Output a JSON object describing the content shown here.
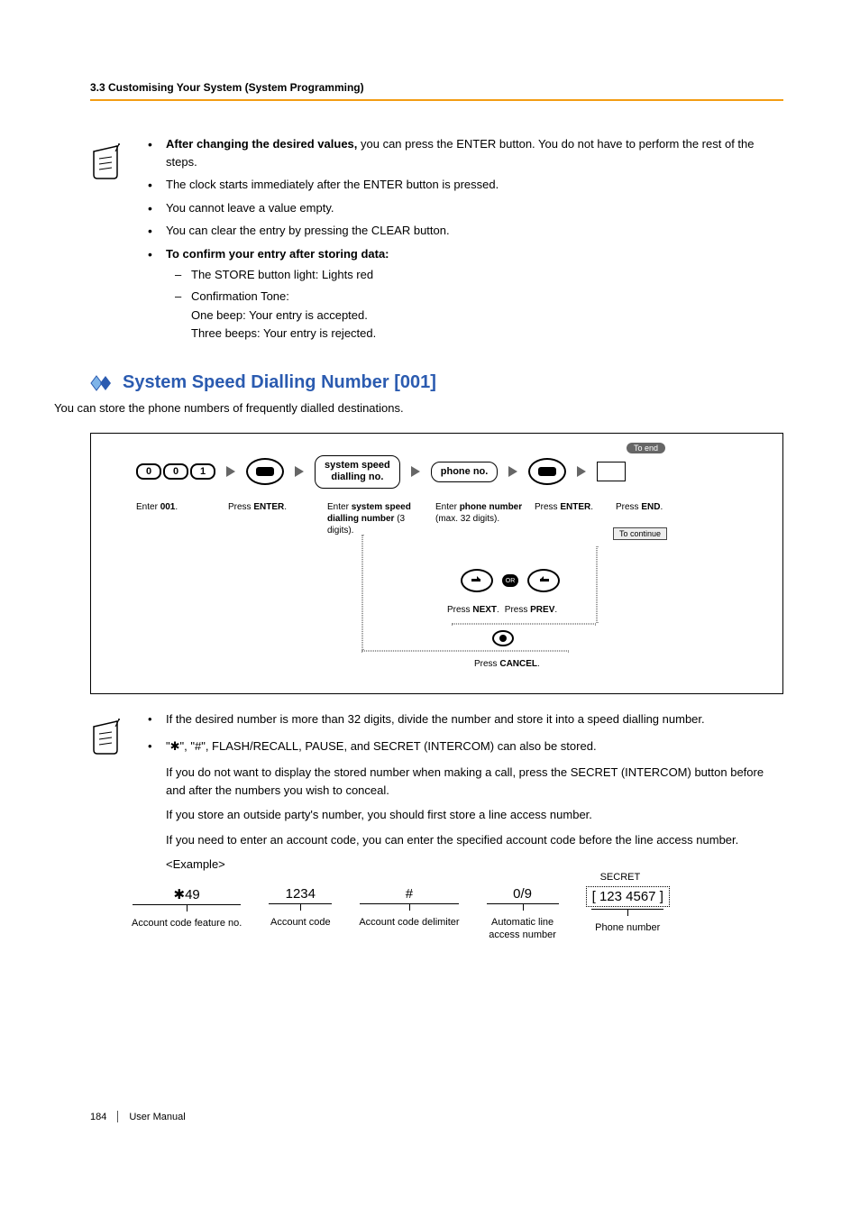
{
  "header": {
    "section_label": "3.3 Customising Your System (System Programming)"
  },
  "notes1": {
    "item1_bold": "After changing the desired values,",
    "item1_rest": " you can press the ENTER button. You do not have to perform the rest of the steps.",
    "item2": "The clock starts immediately after the ENTER button is pressed.",
    "item3": "You cannot leave a value empty.",
    "item4": "You can clear the entry by pressing the CLEAR button.",
    "item5_bold": "To confirm your entry after storing data:",
    "sub1": "The STORE button light: Lights red",
    "sub2": "Confirmation Tone:",
    "sub2a": "One beep: Your entry is accepted.",
    "sub2b": "Three beeps: Your entry is rejected."
  },
  "heading_section": "System Speed Dialling Number [001]",
  "intro": "You can store the phone numbers of frequently dialled destinations.",
  "flow": {
    "key1": "0",
    "key2": "0",
    "key3": "1",
    "cap_enter001_a": "Enter ",
    "cap_enter001_b": "001",
    "cap_enter001_c": ".",
    "cap_press_enter_a": "Press ",
    "cap_press_enter_b": "ENTER",
    "cap_press_enter_c": ".",
    "box_ssd": "system speed dialling no.",
    "cap_ssd_a": "Enter ",
    "cap_ssd_b": "system speed dialling number",
    "cap_ssd_c": " (3 digits).",
    "box_phone": "phone no.",
    "cap_phone_a": "Enter ",
    "cap_phone_b": "phone number",
    "cap_phone_c": "(max. 32 digits).",
    "cap_end_a": "Press ",
    "cap_end_b": "END",
    "cap_end_c": ".",
    "to_end": "To end",
    "to_continue": "To continue",
    "or": "OR",
    "nav_next_a": "Press ",
    "nav_next_b": "NEXT",
    "nav_next_c": ".",
    "nav_prev_a": "Press ",
    "nav_prev_b": "PREV",
    "nav_prev_c": ".",
    "cancel_a": "Press ",
    "cancel_b": "CANCEL",
    "cancel_c": "."
  },
  "notes2": {
    "item1": "If the desired number is more than 32 digits, divide the number and store it into a speed dialling number.",
    "item2": "\"    \", \"#\", FLASH/RECALL, PAUSE, and SECRET (INTERCOM) can also be stored.",
    "para1": "If you do not want to display the stored number when making a call, press the SECRET (INTERCOM) button before and after the numbers you wish to conceal.",
    "para2": "If you store an outside party's number, you should first store a line access number.",
    "para3": "If you need to enter an account code, you can enter the specified account code before the line access number.",
    "example_label": "<Example>"
  },
  "example": {
    "col1_val": "49",
    "col1_label": "Account code feature no.",
    "col2_val": "1234",
    "col2_label": "Account code",
    "col3_val": "#",
    "col3_label": "Account code delimiter",
    "col4_val": "0/9",
    "col4_label": "Automatic line access number",
    "col5_val": "123  4567",
    "col5_label": "Phone number",
    "secret": "SECRET",
    "brackets_l": "[",
    "brackets_r": "]"
  },
  "footer": {
    "page": "184",
    "manual": "User Manual"
  }
}
